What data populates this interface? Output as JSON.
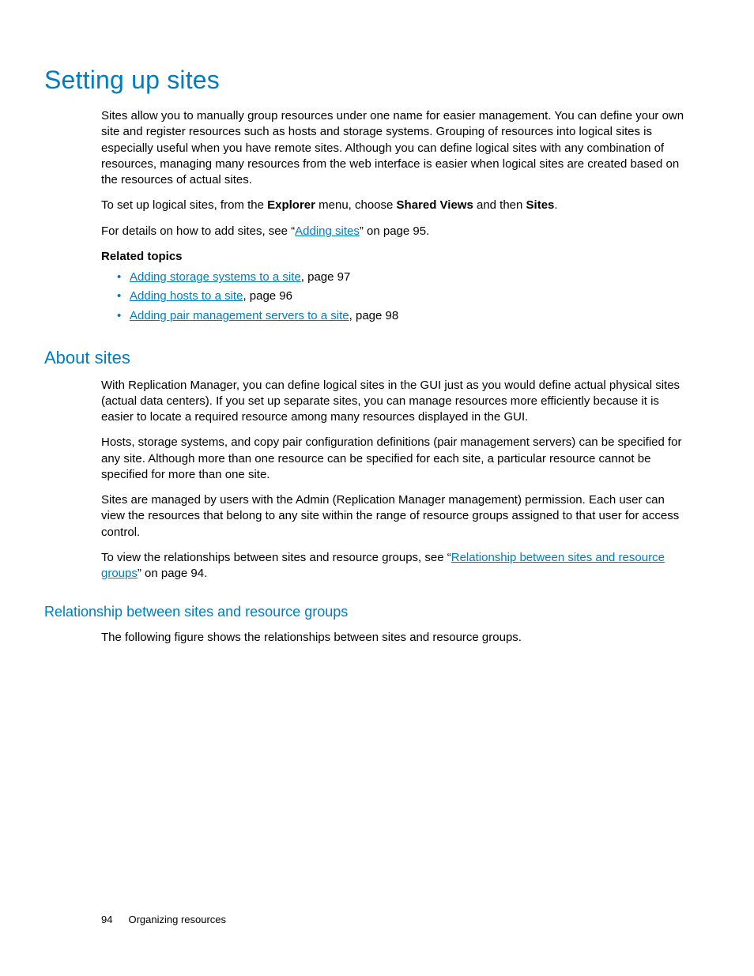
{
  "h1": "Setting up sites",
  "p1": "Sites allow you to manually group resources under one name for easier management. You can define your own site and register resources such as hosts and storage systems. Grouping of resources into logical sites is especially useful when you have remote sites. Although you can define logical sites with any combination of resources, managing many resources from the web interface is easier when logical sites are created based on the resources of actual sites.",
  "p2": {
    "a": "To set up logical sites, from the ",
    "b": "Explorer",
    "c": " menu, choose ",
    "d": "Shared Views",
    "e": " and then ",
    "f": "Sites",
    "g": "."
  },
  "p3": {
    "a": " For details on how to add sites, see “",
    "link": "Adding sites",
    "b": "” on page 95."
  },
  "related": {
    "label": "Related topics",
    "items": [
      {
        "link": "Adding storage systems to a site",
        "tail": ", page 97"
      },
      {
        "link": "Adding hosts to a site",
        "tail": ", page 96"
      },
      {
        "link": "Adding pair management servers to a site",
        "tail": ", page 98"
      }
    ]
  },
  "h2": "About sites",
  "p4": "With Replication Manager, you can define logical sites in the GUI just as you would define actual physical sites (actual data centers). If you set up separate sites, you can manage resources more efficiently because it is easier to locate a required resource among many resources displayed in the GUI.",
  "p5": "Hosts, storage systems, and copy pair configuration definitions (pair management servers) can be specified for any site. Although more than one resource can be specified for each site, a particular resource cannot be specified for more than one site.",
  "p6": "Sites are managed by users with the Admin (Replication Manager management) permission. Each user can view the resources that belong to any site within the range of resource groups assigned to that user for access control.",
  "p7": {
    "a": "To view the relationships between sites and resource groups, see “",
    "link": "Relationship between sites and resource groups",
    "b": "” on page 94."
  },
  "h3": "Relationship between sites and resource groups",
  "p8": "The following figure shows the relationships between sites and resource groups.",
  "footer": {
    "page": "94",
    "section": "Organizing resources"
  }
}
